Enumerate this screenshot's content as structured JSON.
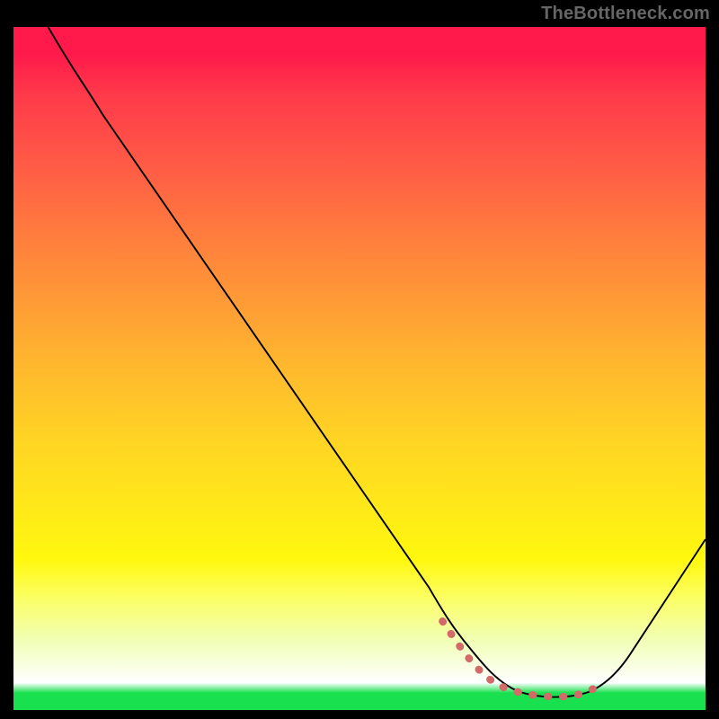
{
  "watermark": "TheBottleneck.com",
  "chart_data": {
    "type": "line",
    "title": "",
    "xlabel": "",
    "ylabel": "",
    "xlim": [
      0,
      100
    ],
    "ylim": [
      0,
      100
    ],
    "grid": false,
    "legend": false,
    "series": [
      {
        "name": "bottleneck-curve",
        "color": "#000000",
        "x": [
          5,
          10,
          15,
          20,
          25,
          30,
          35,
          40,
          45,
          50,
          55,
          60,
          62,
          65,
          68,
          70,
          73,
          76,
          80,
          83,
          85,
          88,
          92,
          96,
          100
        ],
        "values": [
          100,
          94,
          87,
          79,
          72,
          64,
          57,
          49,
          42,
          34,
          27,
          19,
          15,
          11,
          7,
          5,
          3,
          2.2,
          2.0,
          2.2,
          3,
          6,
          12,
          18,
          25
        ]
      },
      {
        "name": "optimal-marker",
        "color": "#d36a6a",
        "x": [
          62,
          64,
          66,
          68,
          70,
          72,
          74,
          76,
          78,
          80,
          82,
          84
        ],
        "values": [
          13,
          10,
          7.5,
          5.5,
          4.2,
          3.2,
          2.6,
          2.3,
          2.2,
          2.3,
          2.7,
          3.6
        ]
      }
    ],
    "gradient_stops": [
      {
        "pos": 0.0,
        "color": "#ff1a4b"
      },
      {
        "pos": 0.5,
        "color": "#ffb92e"
      },
      {
        "pos": 0.85,
        "color": "#fff80e"
      },
      {
        "pos": 0.96,
        "color": "#ffffff"
      },
      {
        "pos": 1.0,
        "color": "#18e04e"
      }
    ]
  }
}
